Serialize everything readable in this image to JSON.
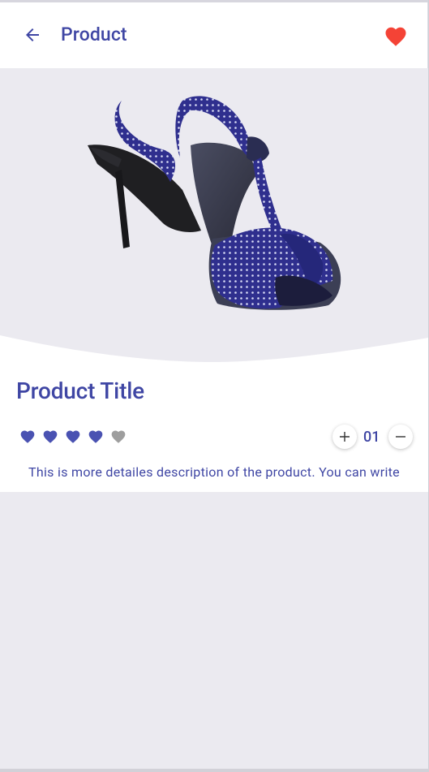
{
  "appbar": {
    "title": "Product",
    "back_icon": "arrow-left-icon",
    "favorite_icon": "heart-icon",
    "favorite_active": true
  },
  "product": {
    "image_alt": "Blue polka dot high heel sandal",
    "title": "Product Title",
    "rating": 4,
    "rating_max": 5,
    "quantity": "01",
    "description": "This is more detailes description of the product. You can write"
  },
  "colors": {
    "primary": "#3f46a4",
    "favorite": "#f44336",
    "star_active": "#4a52b2",
    "star_inactive": "#9e9e9e",
    "background": "#ebeaf0"
  }
}
